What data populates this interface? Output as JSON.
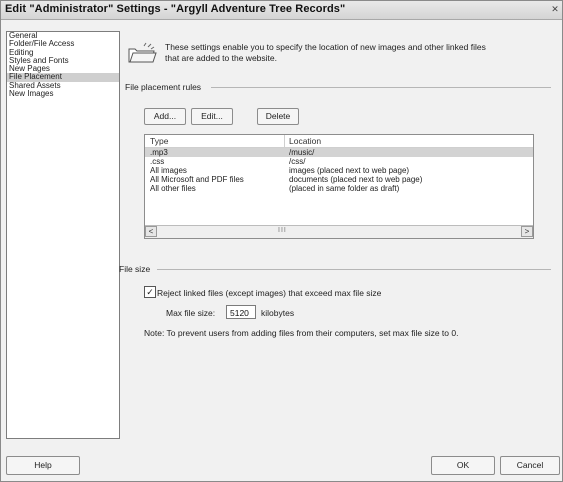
{
  "window": {
    "title": "Edit \"Administrator\" Settings - \"Argyll Adventure Tree Records\"",
    "close_glyph": "✕"
  },
  "sidebar": {
    "items": [
      {
        "label": "General",
        "selected": false
      },
      {
        "label": "Folder/File Access",
        "selected": false
      },
      {
        "label": "Editing",
        "selected": false
      },
      {
        "label": "Styles and Fonts",
        "selected": false
      },
      {
        "label": "New Pages",
        "selected": false
      },
      {
        "label": "File Placement",
        "selected": true
      },
      {
        "label": "Shared Assets",
        "selected": false
      },
      {
        "label": "New Images",
        "selected": false
      }
    ]
  },
  "main": {
    "info_line1": "These settings enable you to specify the location of new images and other linked files",
    "info_line2": "that are added to the website.",
    "placement_section": "File placement rules",
    "buttons": {
      "add": "Add...",
      "edit": "Edit...",
      "delete": "Delete"
    },
    "table": {
      "columns": [
        "Type",
        "Location"
      ],
      "rows": [
        {
          "type": ".mp3",
          "location": "/music/",
          "selected": true
        },
        {
          "type": ".css",
          "location": "/css/",
          "selected": false
        },
        {
          "type": "All images",
          "location": "images (placed next to web page)",
          "selected": false
        },
        {
          "type": "All Microsoft and PDF files",
          "location": "documents (placed next to web page)",
          "selected": false
        },
        {
          "type": "All other files",
          "location": "(placed in same folder as draft)",
          "selected": false
        }
      ]
    },
    "scroll": {
      "left": "<",
      "right": ">",
      "grip": "III"
    },
    "size_section": "File size",
    "reject_checkbox": {
      "checked": true,
      "mark": "✓",
      "label": "Reject linked files (except images) that exceed max file size"
    },
    "max_size_label": "Max file size:",
    "max_size_value": "5120",
    "max_size_unit": "kilobytes",
    "note": "Note: To prevent users from adding files from their computers, set max file size to 0."
  },
  "footer": {
    "help": "Help",
    "ok": "OK",
    "cancel": "Cancel"
  }
}
